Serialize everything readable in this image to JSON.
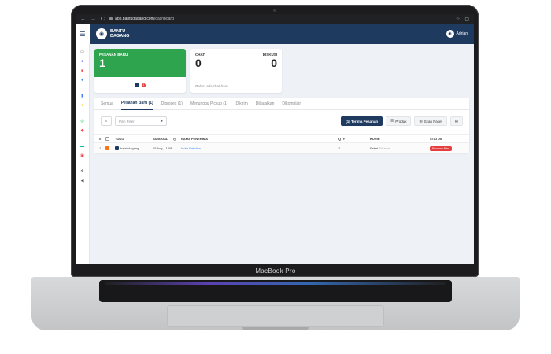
{
  "device": {
    "label": "MacBook Pro"
  },
  "browser": {
    "url_domain": "app.bantudagang.com",
    "url_path": "/dashboard",
    "nav_back": "←",
    "nav_forward": "→",
    "nav_reload": "C"
  },
  "app": {
    "brand_name": "BANTU DAGANG",
    "user_name": "Adrian"
  },
  "sidebar": {
    "icons": [
      {
        "name": "monitor-icon",
        "glyph": "▭",
        "color": "#555555"
      },
      {
        "name": "chat-icon",
        "glyph": "●",
        "color": "#4f46e5"
      },
      {
        "name": "box-icon",
        "glyph": "■",
        "color": "#ef4444"
      },
      {
        "name": "user-icon",
        "glyph": "●",
        "color": "#3b82f6"
      },
      {
        "name": "chart-icon",
        "glyph": "▮",
        "color": "#3b82f6"
      },
      {
        "name": "star-icon",
        "glyph": "●",
        "color": "#facc15"
      },
      {
        "name": "refresh-icon",
        "glyph": "◎",
        "color": "#22c55e"
      },
      {
        "name": "tag-icon",
        "glyph": "◆",
        "color": "#ef4444"
      },
      {
        "name": "store-icon",
        "glyph": "▬",
        "color": "#14b8a6"
      },
      {
        "name": "document-icon",
        "glyph": "▣",
        "color": "#ef4444"
      },
      {
        "name": "gear-icon",
        "glyph": "✻",
        "color": "#555555"
      },
      {
        "name": "megaphone-icon",
        "glyph": "◀",
        "color": "#555555"
      }
    ]
  },
  "cards": {
    "new_orders": {
      "label": "PESANAN BARU",
      "count": "1",
      "badge": "1"
    },
    "chat": {
      "label": "CHAT",
      "count": "0"
    },
    "diskusi": {
      "label": "DISKUSI",
      "count": "0"
    },
    "empty_chat": "Belum ada chat baru"
  },
  "tabs": [
    {
      "label": "Semua",
      "active": false
    },
    {
      "label": "Pesanan Baru (1)",
      "active": true
    },
    {
      "label": "Diproses (1)",
      "active": false
    },
    {
      "label": "Menunggu Pickup (1)",
      "active": false
    },
    {
      "label": "Dikirim",
      "active": false
    },
    {
      "label": "Dibatalkan",
      "active": false
    },
    {
      "label": "Dikomplain",
      "active": false
    }
  ],
  "filters": {
    "search_icon": "⌕",
    "filter_placeholder": "Pilih Filter",
    "accept_button": "(1) Terima Pesanan",
    "produk_button": "Produk",
    "scan_button": "Scan Paket",
    "print_icon": "▤"
  },
  "table": {
    "headers": {
      "no": "#",
      "toko": "TOKO",
      "tanggal": "TANGGAL",
      "nama": "NAMA PENERIMA",
      "qty": "QTY",
      "kurir": "KURIR",
      "status": "STATUS"
    },
    "rows": [
      {
        "no": "1",
        "toko": "bantudagang",
        "tanggal": "15 Aug, 11:08",
        "nama": "Indra Pahvtha",
        "qty": "1",
        "kurir": "Paket",
        "kurir_sub": "SiCepat",
        "status": "Pesanan Baru"
      }
    ]
  }
}
